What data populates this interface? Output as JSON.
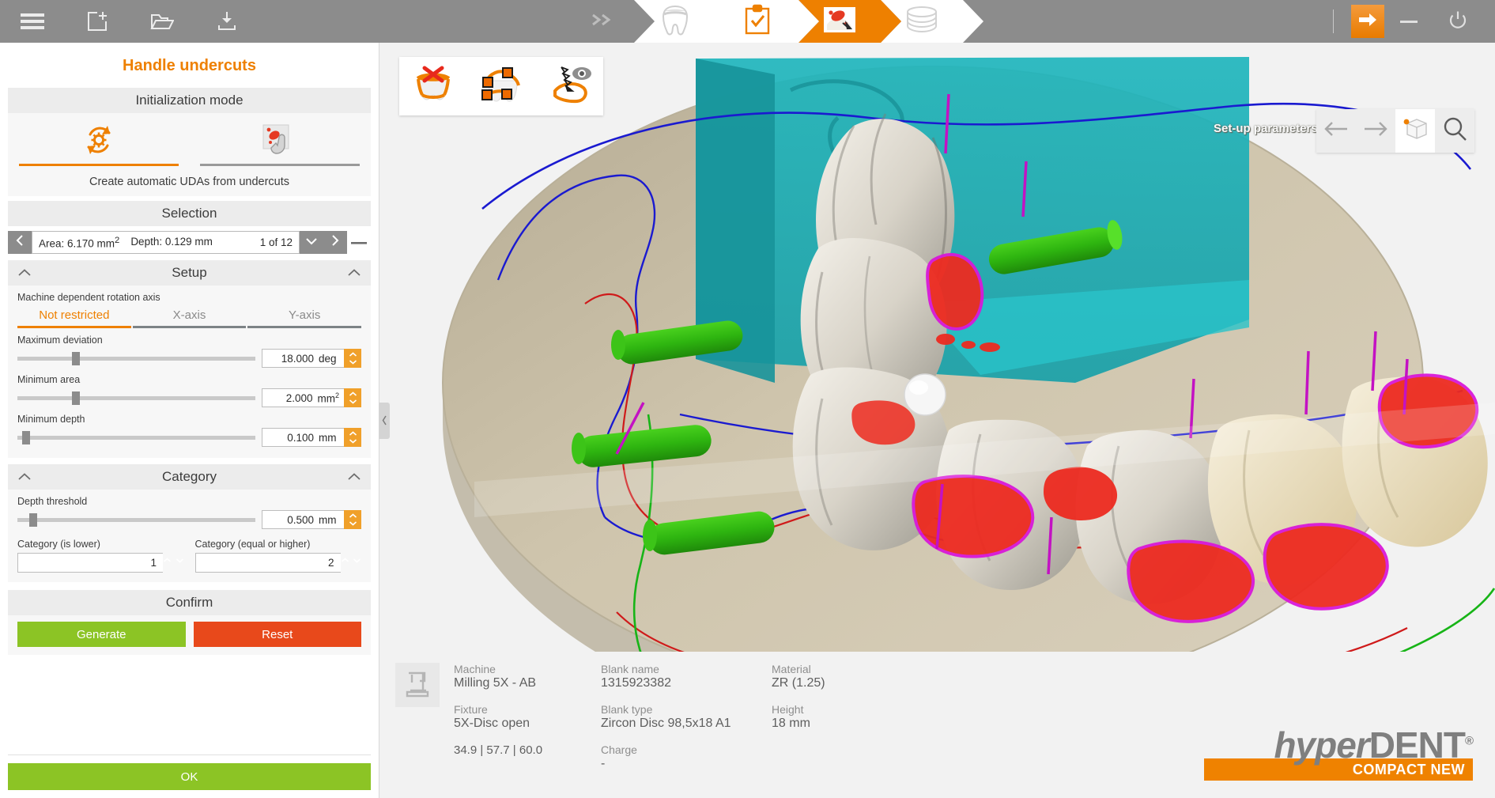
{
  "topbar": {
    "icons": [
      {
        "name": "hamburger-menu-icon",
        "label": "Menu"
      },
      {
        "name": "new-project-icon",
        "label": "New"
      },
      {
        "name": "open-folder-icon",
        "label": "Open"
      },
      {
        "name": "save-download-icon",
        "label": "Save"
      }
    ],
    "workflow": [
      {
        "name": "workflow-expand",
        "label": "More steps",
        "icon": "double-chevron-right-icon",
        "state": "grey"
      },
      {
        "name": "workflow-step-tooth",
        "label": "Restoration",
        "icon": "tooth-icon",
        "state": "idle"
      },
      {
        "name": "workflow-step-clipboard",
        "label": "Job check",
        "icon": "clipboard-check-icon",
        "state": "idle"
      },
      {
        "name": "workflow-step-undercuts",
        "label": "Handle undercuts",
        "icon": "undercut-edit-icon",
        "state": "active"
      },
      {
        "name": "workflow-step-blank",
        "label": "Blank",
        "icon": "disc-stack-icon",
        "state": "idle"
      }
    ],
    "right": [
      {
        "name": "next-arrow-button",
        "label": "Next",
        "icon": "arrow-right-icon"
      },
      {
        "name": "minimize-button",
        "label": "Minimize",
        "icon": "minimize-icon"
      },
      {
        "name": "power-button",
        "label": "Exit",
        "icon": "power-icon"
      }
    ]
  },
  "panel": {
    "title": "Handle undercuts",
    "initialization": {
      "heading": "Initialization mode",
      "tabs": [
        {
          "label": "Automatic",
          "icon": "auto-gear-refresh-icon",
          "selected": true
        },
        {
          "label": "Manual",
          "icon": "manual-hand-pick-icon",
          "selected": false
        }
      ],
      "caption": "Create automatic UDAs from undercuts"
    },
    "selection": {
      "heading": "Selection",
      "prev_label": "‹",
      "next_label": "›",
      "area_text": "Area: 6.170 mm",
      "area_sup": "2",
      "depth_text": "Depth: 0.129 mm",
      "counter": "1 of 12",
      "dropdown_icon": "chevron-down-icon",
      "remove_icon": "minus-icon"
    },
    "setup": {
      "heading": "Setup",
      "axis_label": "Machine dependent rotation axis",
      "axis_tabs": [
        {
          "label": "Not restricted",
          "selected": true
        },
        {
          "label": "X-axis",
          "selected": false
        },
        {
          "label": "Y-axis",
          "selected": false
        }
      ],
      "fields": [
        {
          "label": "Maximum deviation",
          "value": "18.000",
          "unit": "deg",
          "unit_sup": "",
          "slider_pct": 23
        },
        {
          "label": "Minimum area",
          "value": "2.000",
          "unit": "mm",
          "unit_sup": "2",
          "slider_pct": 23
        },
        {
          "label": "Minimum depth",
          "value": "0.100",
          "unit": "mm",
          "unit_sup": "",
          "slider_pct": 2
        }
      ]
    },
    "category": {
      "heading": "Category",
      "threshold": {
        "label": "Depth threshold",
        "value": "0.500",
        "unit": "mm",
        "slider_pct": 5
      },
      "lower": {
        "label": "Category (is lower)",
        "value": "1"
      },
      "higher": {
        "label": "Category (equal or higher)",
        "value": "2"
      }
    },
    "confirm": {
      "heading": "Confirm",
      "generate": "Generate",
      "reset": "Reset"
    },
    "ok": "OK"
  },
  "viewport": {
    "tools": [
      {
        "name": "clear-undercuts-tool",
        "label": "Remove all",
        "icon": "tooth-cross-icon"
      },
      {
        "name": "edit-points-tool",
        "label": "Edit points",
        "icon": "tooth-nodes-icon"
      },
      {
        "name": "visibility-tool",
        "label": "Show/hide",
        "icon": "arrow-eye-icon"
      }
    ],
    "hint": "Set-up parameters and click 'Generate'.",
    "nav": [
      {
        "name": "nav-back-button",
        "label": "Back",
        "icon": "arrow-left-icon"
      },
      {
        "name": "nav-forward-button",
        "label": "Forward",
        "icon": "arrow-right-icon"
      },
      {
        "name": "view-cube-button",
        "label": "View cube",
        "icon": "cube-icon"
      },
      {
        "name": "zoom-button",
        "label": "Zoom",
        "icon": "magnifier-icon"
      }
    ]
  },
  "info": {
    "machine_icon": "milling-machine-icon",
    "columns": [
      [
        {
          "label": "Machine",
          "value": "Milling 5X - AB"
        },
        {
          "label": "Fixture",
          "value": "5X-Disc open"
        }
      ],
      [
        {
          "label": "Blank name",
          "value": "1315923382"
        },
        {
          "label": "Blank type",
          "value": "Zircon Disc 98,5x18 A1"
        },
        {
          "label": "Charge",
          "value": "-"
        }
      ],
      [
        {
          "label": "Material",
          "value": "ZR (1.25)"
        },
        {
          "label": "Height",
          "value": "18 mm"
        }
      ]
    ],
    "coords": "34.9  | 57.7 | 60.0"
  },
  "logo": {
    "part1": "hyper",
    "part2": "DENT",
    "registered": "®",
    "tagline": "COMPACT NEW"
  },
  "colors": {
    "accent_orange": "#ee8000",
    "brand_orange": "#ef8200",
    "generate_green": "#8cc425",
    "reset_red": "#e8491b",
    "topbar_grey": "#8c8c8c",
    "spinner_orange": "#f0a02a"
  }
}
